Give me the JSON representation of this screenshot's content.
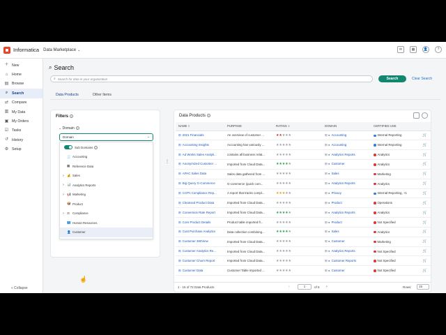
{
  "topbar": {
    "brand": "Informatica",
    "app_switcher": "Data Marketplace",
    "app_chevron": "chevron-down-icon"
  },
  "sidebar": {
    "items": [
      {
        "label": "New",
        "icon": "plus-icon"
      },
      {
        "label": "Home",
        "icon": "home-icon"
      },
      {
        "label": "Browse",
        "icon": "browse-icon"
      },
      {
        "label": "Search",
        "icon": "search-icon",
        "active": true
      },
      {
        "label": "Compare",
        "icon": "compare-icon"
      },
      {
        "label": "My Data",
        "icon": "data-icon"
      },
      {
        "label": "My Orders",
        "icon": "orders-icon"
      },
      {
        "label": "Tasks",
        "icon": "tasks-icon"
      },
      {
        "label": "History",
        "icon": "history-icon"
      },
      {
        "label": "Setup",
        "icon": "gear-icon"
      }
    ],
    "collapse": "Collapse"
  },
  "search": {
    "title": "Search",
    "placeholder": "Search for data in your organization",
    "button": "Search",
    "clear": "Clear Search"
  },
  "tabs": [
    "Data Products",
    "Other Items"
  ],
  "filters": {
    "title": "Filters",
    "domain_label": "Domain",
    "domain_value": "Domain",
    "subdomains_label": "Sub Domains",
    "options": [
      {
        "label": "Accounting",
        "expand": false,
        "icon": "🧾"
      },
      {
        "label": "Reference Data",
        "expand": false,
        "icon": "▦"
      },
      {
        "label": "Sales",
        "expand": true,
        "icon": "💰"
      },
      {
        "label": "Analytics Reports",
        "expand": true,
        "icon": "📊"
      },
      {
        "label": "Marketing",
        "expand": true,
        "icon": "📢"
      },
      {
        "label": "Product",
        "expand": false,
        "icon": "📦"
      },
      {
        "label": "Compliance",
        "expand": true,
        "icon": "⚖"
      },
      {
        "label": "Human Resources",
        "expand": false,
        "icon": "👥"
      },
      {
        "label": "Customer",
        "expand": false,
        "icon": "👤",
        "hover": true
      }
    ]
  },
  "products": {
    "title": "Data Products",
    "columns": [
      "NAME",
      "PURPOSE",
      "RATING",
      "DOMAIN",
      "CERTIFIED USE"
    ],
    "rows": [
      {
        "name": "2021 Financials",
        "purpose": "An overview of customer ...",
        "rating": 2,
        "domain": "Accounting",
        "cert": "Internal Reporting",
        "cert_color": "#2f7fd6"
      },
      {
        "name": "Accounting Insights",
        "purpose": "Accounting has variously ...",
        "rating": 0,
        "domain": "Accounting",
        "cert": "Internal Reporting",
        "cert_color": "#2f7fd6"
      },
      {
        "name": "Ad Works Sales Analyti...",
        "purpose": "contains all business relat...",
        "rating": 0,
        "domain": "Analytics Reports",
        "cert": "Analytics",
        "cert_color": "#d93838"
      },
      {
        "name": "Anonymized Customer ...",
        "purpose": "Imported from Cloud Data...",
        "rating": 4,
        "domain": "Customer",
        "cert": "Analytics",
        "cert_color": "#d93838"
      },
      {
        "name": "APAC Sales Data",
        "purpose": "Sales data gathered from ...",
        "rating": 0,
        "domain": "Sales",
        "cert": "Marketing",
        "cert_color": "#d93838"
      },
      {
        "name": "Big Query G-Commerce",
        "purpose": "G-commerce (quick com...",
        "rating": 0,
        "domain": "Analytics Reports",
        "cert": "Analytics",
        "cert_color": "#d93838"
      },
      {
        "name": "CCPA Compliance Rep...",
        "purpose": "A report that tracks compl...",
        "rating": 3,
        "domain": "Privacy",
        "cert": "Internal Reporting, +1",
        "cert_color": "#2f7fd6"
      },
      {
        "name": "Cleansed Product Data",
        "purpose": "Imported from Cloud Data...",
        "rating": 0,
        "domain": "Product",
        "cert": "Operations",
        "cert_color": "#d93838"
      },
      {
        "name": "Conversion Rate Report",
        "purpose": "Imported from Cloud Data...",
        "rating": 4,
        "domain": "Analytics Reports",
        "cert": "Analytics",
        "cert_color": "#d93838"
      },
      {
        "name": "Core Product Details",
        "purpose": "Product table imported fr...",
        "rating": 0,
        "domain": "Product",
        "cert": "Not Specified",
        "cert_color": "#d93838"
      },
      {
        "name": "Cust Purchase Analytics",
        "purpose": "Data collection combining...",
        "rating": 4,
        "domain": "Sales",
        "cert": "Analytics",
        "cert_color": "#d93838"
      },
      {
        "name": "Customer 360View",
        "purpose": "Imported from Cloud Data...",
        "rating": 0,
        "domain": "Customer",
        "cert": "Marketing",
        "cert_color": "#d93838"
      },
      {
        "name": "Customer Analytics Re...",
        "purpose": "Imported from Cloud Data...",
        "rating": 0,
        "domain": "Analytics Reports",
        "cert": "Not Specified",
        "cert_color": "#d93838"
      },
      {
        "name": "Customer Churn Report",
        "purpose": "Imported from Cloud Data...",
        "rating": 0,
        "domain": "Customer Reports",
        "cert": "Not Specified",
        "cert_color": "#d93838"
      },
      {
        "name": "Customer Data",
        "purpose": "Customer Table imported ...",
        "rating": 0,
        "domain": "Customer",
        "cert": "Not Specified",
        "cert_color": "#d93838"
      }
    ],
    "pager": {
      "count": "1 - 15 of 72 Data Products",
      "page": "1",
      "of": "of 5",
      "rows_label": "Rows:",
      "rows_value": "15"
    }
  },
  "colors": {
    "accent": "#12876f",
    "link": "#1a56b8",
    "star": "#2e9e4e",
    "star_low": "#b33a3a",
    "star_mid": "#e0a020"
  }
}
